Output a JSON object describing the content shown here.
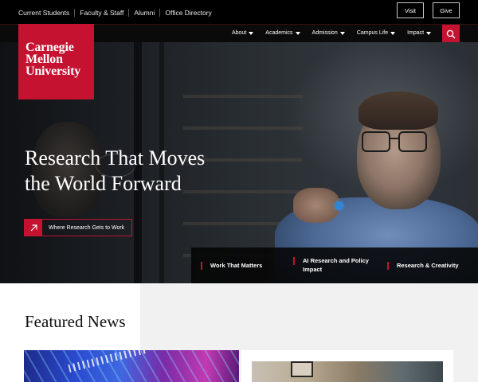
{
  "utility_bar": {
    "links": [
      "Current Students",
      "Faculty & Staff",
      "Alumni",
      "Office Directory"
    ],
    "visit_label": "Visit",
    "give_label": "Give"
  },
  "logo": {
    "line1": "Carnegie",
    "line2": "Mellon",
    "line3": "University"
  },
  "nav": {
    "items": [
      "About",
      "Academics",
      "Admission",
      "Campus Life",
      "Impact"
    ],
    "search_icon": "search-icon"
  },
  "hero": {
    "title_line1": "Research That Moves",
    "title_line2": "the World Forward",
    "cta_label": "Where Research Gets to Work",
    "cta_icon": "arrow-up-right-icon"
  },
  "quick_links": [
    "Work That Matters",
    "AI Research and Policy Impact",
    "Research & Creativity"
  ],
  "featured": {
    "heading": "Featured News"
  },
  "colors": {
    "brand_red": "#c41230",
    "bar_black": "#000000"
  }
}
